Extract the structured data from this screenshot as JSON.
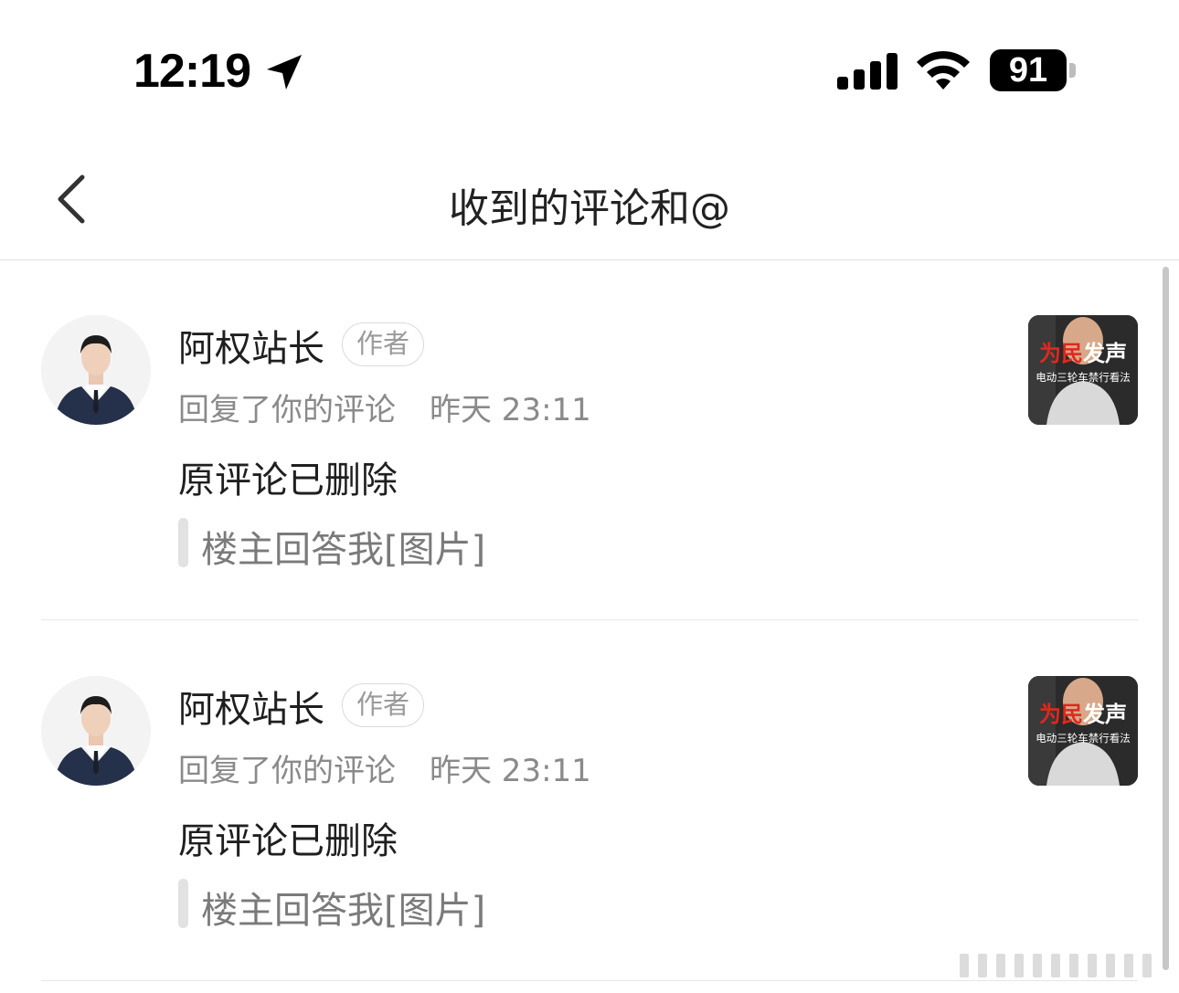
{
  "status_bar": {
    "time": "12:19",
    "battery": "91",
    "icons": [
      "location-arrow-icon",
      "signal-icon",
      "wifi-icon",
      "battery-icon"
    ]
  },
  "nav": {
    "back_icon": "chevron-left-icon",
    "title": "收到的评论和@"
  },
  "comments": [
    {
      "username": "阿权站长",
      "badge": "作者",
      "action": "回复了你的评论",
      "time": "昨天 23:11",
      "body": "原评论已删除",
      "quote": "楼主回答我[图片]",
      "thumb_title_red": "为民",
      "thumb_title_white": "发声",
      "thumb_subtitle": "电动三轮车禁行看法"
    },
    {
      "username": "阿权站长",
      "badge": "作者",
      "action": "回复了你的评论",
      "time": "昨天 23:11",
      "body": "原评论已删除",
      "quote": "楼主回答我[图片]",
      "thumb_title_red": "为民",
      "thumb_title_white": "发声",
      "thumb_subtitle": "电动三轮车禁行看法"
    }
  ],
  "colors": {
    "background": "#ffffff",
    "text_primary": "#1f1f1f",
    "text_secondary": "#8a8a8a",
    "badge_border": "#dadada",
    "thumb_red": "#e0281e"
  }
}
